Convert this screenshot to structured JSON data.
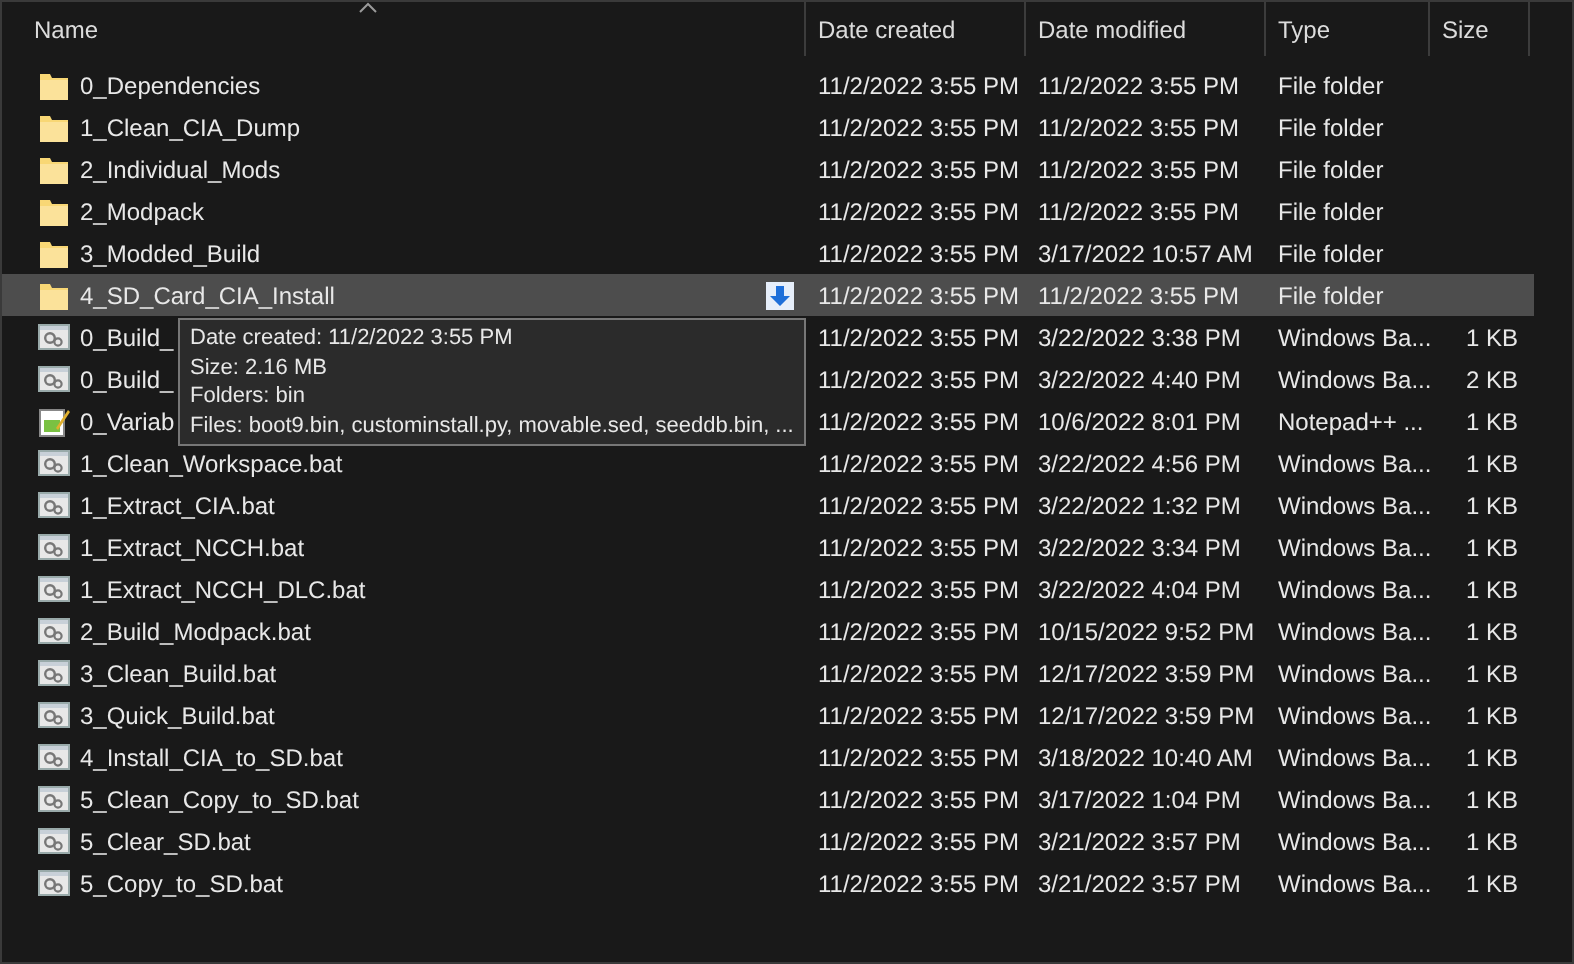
{
  "columns": [
    {
      "label": "Name",
      "sorted": true
    },
    {
      "label": "Date created",
      "sorted": false
    },
    {
      "label": "Date modified",
      "sorted": false
    },
    {
      "label": "Type",
      "sorted": false
    },
    {
      "label": "Size",
      "sorted": false
    }
  ],
  "rows": [
    {
      "kind": "folder",
      "name": "0_Dependencies",
      "created": "11/2/2022 3:55 PM",
      "modified": "11/2/2022 3:55 PM",
      "type": "File folder",
      "selected": false
    },
    {
      "kind": "folder",
      "name": "1_Clean_CIA_Dump",
      "created": "11/2/2022 3:55 PM",
      "modified": "11/2/2022 3:55 PM",
      "type": "File folder",
      "selected": false
    },
    {
      "kind": "folder",
      "name": "2_Individual_Mods",
      "created": "11/2/2022 3:55 PM",
      "modified": "11/2/2022 3:55 PM",
      "type": "File folder",
      "selected": false
    },
    {
      "kind": "folder",
      "name": "2_Modpack",
      "created": "11/2/2022 3:55 PM",
      "modified": "11/2/2022 3:55 PM",
      "type": "File folder",
      "selected": false
    },
    {
      "kind": "folder",
      "name": "3_Modded_Build",
      "created": "11/2/2022 3:55 PM",
      "modified": "3/17/2022 10:57 AM",
      "type": "File folder",
      "selected": false
    },
    {
      "kind": "folder",
      "name": "4_SD_Card_CIA_Install",
      "created": "11/2/2022 3:55 PM",
      "modified": "11/2/2022 3:55 PM",
      "type": "File folder",
      "selected": true,
      "sync": true
    },
    {
      "kind": "bat",
      "name": "0_Build_",
      "created": "11/2/2022 3:55 PM",
      "modified": "3/22/2022 3:38 PM",
      "type": "Windows Ba...",
      "size": "1 KB",
      "selected": false
    },
    {
      "kind": "bat",
      "name": "0_Build_",
      "created": "11/2/2022 3:55 PM",
      "modified": "3/22/2022 4:40 PM",
      "type": "Windows Ba...",
      "size": "2 KB",
      "selected": false
    },
    {
      "kind": "notepad",
      "name": "0_Variab",
      "created": "11/2/2022 3:55 PM",
      "modified": "10/6/2022 8:01 PM",
      "type": "Notepad++ ...",
      "size": "1 KB",
      "selected": false
    },
    {
      "kind": "bat",
      "name": "1_Clean_Workspace.bat",
      "created": "11/2/2022 3:55 PM",
      "modified": "3/22/2022 4:56 PM",
      "type": "Windows Ba...",
      "size": "1 KB",
      "selected": false
    },
    {
      "kind": "bat",
      "name": "1_Extract_CIA.bat",
      "created": "11/2/2022 3:55 PM",
      "modified": "3/22/2022 1:32 PM",
      "type": "Windows Ba...",
      "size": "1 KB",
      "selected": false
    },
    {
      "kind": "bat",
      "name": "1_Extract_NCCH.bat",
      "created": "11/2/2022 3:55 PM",
      "modified": "3/22/2022 3:34 PM",
      "type": "Windows Ba...",
      "size": "1 KB",
      "selected": false
    },
    {
      "kind": "bat",
      "name": "1_Extract_NCCH_DLC.bat",
      "created": "11/2/2022 3:55 PM",
      "modified": "3/22/2022 4:04 PM",
      "type": "Windows Ba...",
      "size": "1 KB",
      "selected": false
    },
    {
      "kind": "bat",
      "name": "2_Build_Modpack.bat",
      "created": "11/2/2022 3:55 PM",
      "modified": "10/15/2022 9:52 PM",
      "type": "Windows Ba...",
      "size": "1 KB",
      "selected": false
    },
    {
      "kind": "bat",
      "name": "3_Clean_Build.bat",
      "created": "11/2/2022 3:55 PM",
      "modified": "12/17/2022 3:59 PM",
      "type": "Windows Ba...",
      "size": "1 KB",
      "selected": false
    },
    {
      "kind": "bat",
      "name": "3_Quick_Build.bat",
      "created": "11/2/2022 3:55 PM",
      "modified": "12/17/2022 3:59 PM",
      "type": "Windows Ba...",
      "size": "1 KB",
      "selected": false
    },
    {
      "kind": "bat",
      "name": "4_Install_CIA_to_SD.bat",
      "created": "11/2/2022 3:55 PM",
      "modified": "3/18/2022 10:40 AM",
      "type": "Windows Ba...",
      "size": "1 KB",
      "selected": false
    },
    {
      "kind": "bat",
      "name": "5_Clean_Copy_to_SD.bat",
      "created": "11/2/2022 3:55 PM",
      "modified": "3/17/2022 1:04 PM",
      "type": "Windows Ba...",
      "size": "1 KB",
      "selected": false
    },
    {
      "kind": "bat",
      "name": "5_Clear_SD.bat",
      "created": "11/2/2022 3:55 PM",
      "modified": "3/21/2022 3:57 PM",
      "type": "Windows Ba...",
      "size": "1 KB",
      "selected": false
    },
    {
      "kind": "bat",
      "name": "5_Copy_to_SD.bat",
      "created": "11/2/2022 3:55 PM",
      "modified": "3/21/2022 3:57 PM",
      "type": "Windows Ba...",
      "size": "1 KB",
      "selected": false
    }
  ],
  "tooltip": {
    "lines": [
      "Date created: 11/2/2022 3:55 PM",
      "Size: 2.16 MB",
      "Folders: bin",
      "Files: boot9.bin, custominstall.py, movable.sed, seeddb.bin, ..."
    ]
  }
}
